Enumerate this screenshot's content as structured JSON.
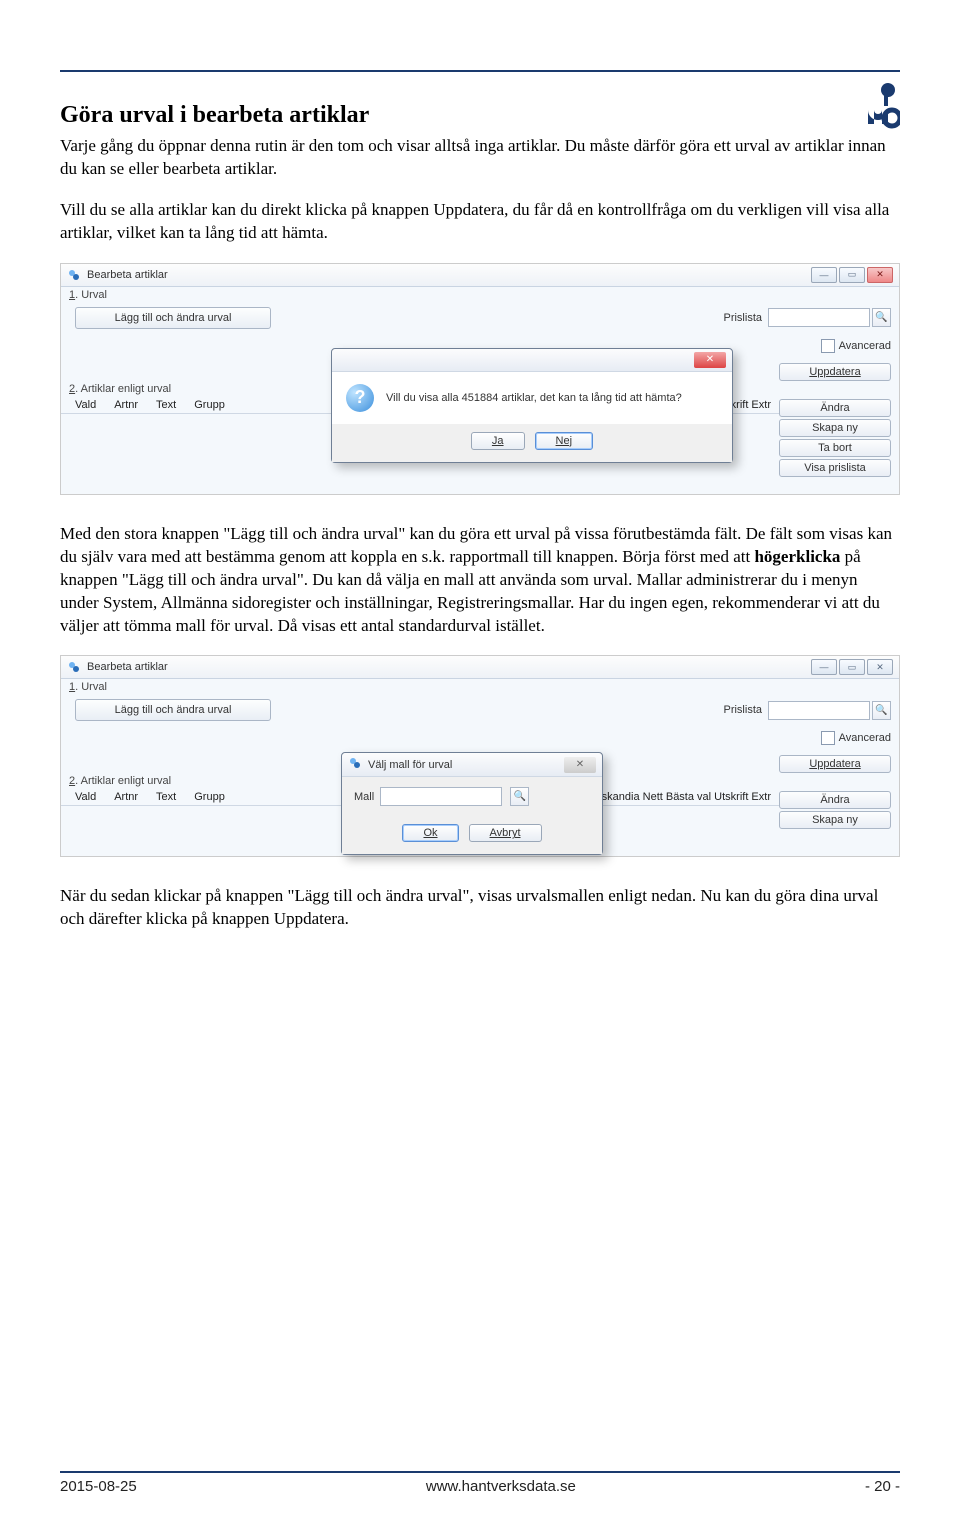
{
  "heading": "Göra urval i bearbeta artiklar",
  "p1": "Varje gång du öppnar denna rutin är den tom och visar alltså inga artiklar. Du måste därför göra ett urval av artiklar innan du kan se eller bearbeta artiklar.",
  "p2": "Vill du se alla artiklar kan du direkt klicka på knappen Uppdatera, du får då en kontrollfråga om du verkligen vill visa alla artiklar, vilket kan ta lång tid att hämta.",
  "p3a": "Med den stora knappen \"Lägg till och ändra urval\" kan du göra ett urval på vissa förutbestämda fält. De fält som visas kan du själv vara med att bestämma genom att koppla en s.k. rapportmall till knappen. Börja först med att ",
  "p3b": "högerklicka",
  "p3c": " på knappen \"Lägg till och ändra urval\". Du kan då välja en mall att använda som urval. Mallar administrerar du i menyn under System, Allmänna sidoregister och inställningar, Registreringsmallar. Har du ingen egen, rekommenderar vi att du väljer att tömma mall för urval. Då visas ett antal standardurval istället.",
  "p4": "När du sedan klickar på knappen \"Lägg till och ändra urval\", visas urvalsmallen enligt nedan. Nu kan du göra dina urval och därefter klicka på knappen Uppdatera.",
  "shot": {
    "window_title": "Bearbeta artiklar",
    "section1_prefix": "1",
    "section1_label": ". Urval",
    "add_btn": "Lägg till och ändra urval",
    "prislista": "Prislista",
    "avancerad": "Avancerad",
    "uppdatera": "Uppdatera",
    "section2_prefix": "2",
    "section2_label": ". Artiklar enligt urval",
    "cols": {
      "vald": "Vald",
      "artnr": "Artnr",
      "text": "Text",
      "grupp": "Grupp",
      "tail1": "Pris-Elektroskandia Nett Bästa val Utskrift Extr",
      "tail2": "toprislista Pris-Elektroskandia Nett Bästa val Utskrift Extr"
    },
    "side": {
      "andra": "Ändra",
      "skapa": "Skapa ny",
      "tabort": "Ta bort",
      "visap": "Visa prislista"
    },
    "confirm_text": "Vill du visa alla 451884 artiklar, det kan ta lång tid att hämta?",
    "ja": "Ja",
    "nej": "Nej",
    "mall_title": "Välj mall för urval",
    "mall": "Mall",
    "ok": "Ok",
    "avbryt": "Avbryt"
  },
  "footer": {
    "date": "2015-08-25",
    "url": "www.hantverksdata.se",
    "page": "- 20 -"
  }
}
